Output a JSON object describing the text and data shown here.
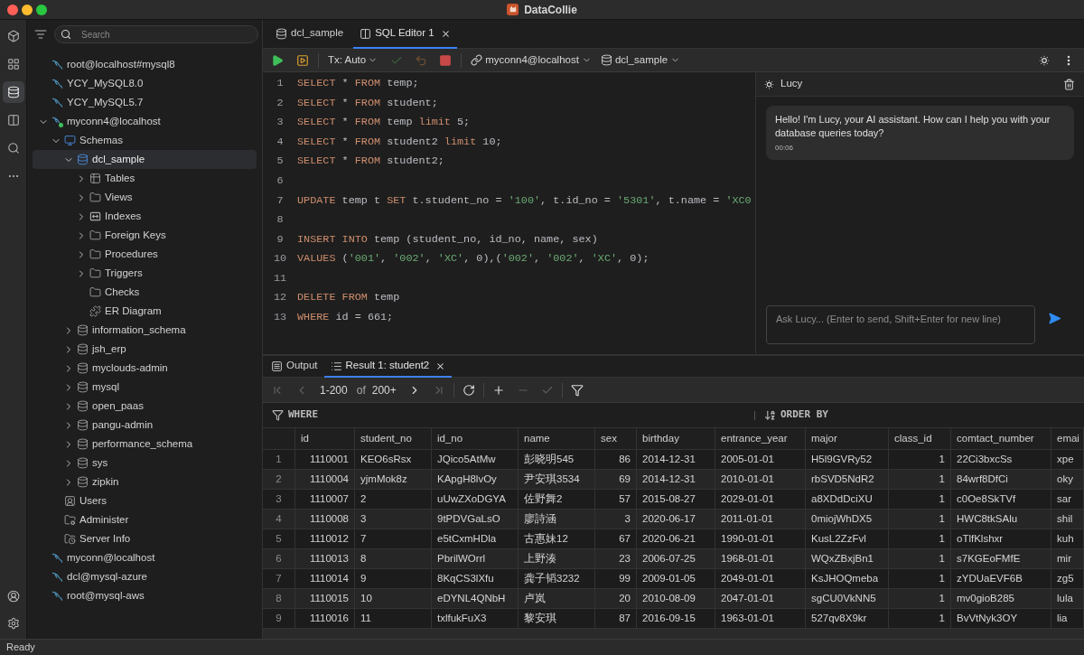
{
  "window": {
    "title": "DataCollie"
  },
  "activity_bar": {
    "items": [
      {
        "selected": false
      },
      {
        "selected": false
      },
      {
        "selected": true
      },
      {
        "selected": false
      },
      {
        "selected": false
      },
      {
        "selected": false
      }
    ]
  },
  "sidebar": {
    "search": {
      "placeholder": "Search"
    },
    "tree": [
      {
        "label": "root@localhost#mysql8",
        "kind": "connection",
        "connected": false,
        "selected": false
      },
      {
        "label": "YCY_MySQL8.0",
        "kind": "connection",
        "connected": false,
        "selected": false
      },
      {
        "label": "YCY_MySQL5.7",
        "kind": "connection",
        "connected": false,
        "selected": false
      },
      {
        "label": "myconn4@localhost",
        "kind": "connection",
        "connected": true,
        "expanded": true,
        "selected": false,
        "children": [
          {
            "label": "Schemas",
            "kind": "schemas",
            "expanded": true,
            "selected": false,
            "children": [
              {
                "label": "dcl_sample",
                "kind": "database",
                "expanded": true,
                "selected": true,
                "children": [
                  {
                    "label": "Tables",
                    "kind": "tables",
                    "expanded": false,
                    "selected": false
                  },
                  {
                    "label": "Views",
                    "kind": "folder",
                    "expanded": false,
                    "selected": false
                  },
                  {
                    "label": "Indexes",
                    "kind": "indexes",
                    "expanded": false,
                    "selected": false
                  },
                  {
                    "label": "Foreign Keys",
                    "kind": "folder",
                    "expanded": false,
                    "selected": false
                  },
                  {
                    "label": "Procedures",
                    "kind": "folder",
                    "expanded": false,
                    "selected": false
                  },
                  {
                    "label": "Triggers",
                    "kind": "folder",
                    "expanded": false,
                    "selected": false
                  },
                  {
                    "label": "Checks",
                    "kind": "folder",
                    "selected": false
                  },
                  {
                    "label": "ER Diagram",
                    "kind": "diagram",
                    "selected": false
                  }
                ]
              },
              {
                "label": "information_schema",
                "kind": "database",
                "expanded": false,
                "selected": false
              },
              {
                "label": "jsh_erp",
                "kind": "database",
                "expanded": false,
                "selected": false
              },
              {
                "label": "myclouds-admin",
                "kind": "database",
                "expanded": false,
                "selected": false
              },
              {
                "label": "mysql",
                "kind": "database",
                "expanded": false,
                "selected": false
              },
              {
                "label": "open_paas",
                "kind": "database",
                "expanded": false,
                "selected": false
              },
              {
                "label": "pangu-admin",
                "kind": "database",
                "expanded": false,
                "selected": false
              },
              {
                "label": "performance_schema",
                "kind": "database",
                "expanded": false,
                "selected": false
              },
              {
                "label": "sys",
                "kind": "database",
                "expanded": false,
                "selected": false
              },
              {
                "label": "zipkin",
                "kind": "database",
                "expanded": false,
                "selected": false
              }
            ]
          },
          {
            "label": "Users",
            "kind": "users",
            "selected": false
          },
          {
            "label": "Administer",
            "kind": "admin",
            "selected": false
          },
          {
            "label": "Server Info",
            "kind": "server-info",
            "selected": false
          }
        ]
      },
      {
        "label": "myconn@localhost",
        "kind": "connection",
        "connected": false,
        "selected": false
      },
      {
        "label": "dcl@mysql-azure",
        "kind": "connection",
        "connected": false,
        "selected": false
      },
      {
        "label": "root@mysql-aws",
        "kind": "connection",
        "connected": false,
        "selected": false
      }
    ]
  },
  "editor": {
    "tabs": [
      {
        "label": "dcl_sample",
        "kind": "database",
        "selected": false,
        "closable": false
      },
      {
        "label": "SQL Editor 1",
        "kind": "sql",
        "selected": true,
        "closable": true
      }
    ],
    "toolbar": {
      "actions": [
        {
          "disabled": false
        },
        {
          "disabled": false
        },
        {
          "disabled": true
        },
        {
          "disabled": true
        },
        {
          "disabled": false
        }
      ],
      "transaction": "Tx: Auto",
      "connection": "myconn4@localhost",
      "database": "dcl_sample"
    },
    "code": {
      "lines": [
        {
          "number": "1",
          "tokens": [
            {
              "kind": "keyword",
              "text": "SELECT"
            },
            {
              "kind": "plain",
              "text": " * "
            },
            {
              "kind": "keyword",
              "text": "FROM"
            },
            {
              "kind": "plain",
              "text": " temp;"
            }
          ]
        },
        {
          "number": "2",
          "tokens": [
            {
              "kind": "keyword",
              "text": "SELECT"
            },
            {
              "kind": "plain",
              "text": " * "
            },
            {
              "kind": "keyword",
              "text": "FROM"
            },
            {
              "kind": "plain",
              "text": " student;"
            }
          ]
        },
        {
          "number": "3",
          "tokens": [
            {
              "kind": "keyword",
              "text": "SELECT"
            },
            {
              "kind": "plain",
              "text": " * "
            },
            {
              "kind": "keyword",
              "text": "FROM"
            },
            {
              "kind": "plain",
              "text": " temp "
            },
            {
              "kind": "keyword",
              "text": "limit"
            },
            {
              "kind": "plain",
              "text": " 5;"
            }
          ]
        },
        {
          "number": "4",
          "tokens": [
            {
              "kind": "keyword",
              "text": "SELECT"
            },
            {
              "kind": "plain",
              "text": " * "
            },
            {
              "kind": "keyword",
              "text": "FROM"
            },
            {
              "kind": "plain",
              "text": " student2 "
            },
            {
              "kind": "keyword",
              "text": "limit"
            },
            {
              "kind": "plain",
              "text": " 10;"
            }
          ]
        },
        {
          "number": "5",
          "tokens": [
            {
              "kind": "keyword",
              "text": "SELECT"
            },
            {
              "kind": "plain",
              "text": " * "
            },
            {
              "kind": "keyword",
              "text": "FROM"
            },
            {
              "kind": "plain",
              "text": " student2;"
            }
          ]
        },
        {
          "number": "6"
        },
        {
          "number": "7",
          "tokens": [
            {
              "kind": "keyword",
              "text": "UPDATE"
            },
            {
              "kind": "plain",
              "text": " temp t "
            },
            {
              "kind": "keyword",
              "text": "SET"
            },
            {
              "kind": "plain",
              "text": " t.student_no = "
            },
            {
              "kind": "string",
              "text": "'100'"
            },
            {
              "kind": "plain",
              "text": ", t.id_no = "
            },
            {
              "kind": "string",
              "text": "'5301'"
            },
            {
              "kind": "plain",
              "text": ", t.name = "
            },
            {
              "kind": "string",
              "text": "'XC0"
            }
          ]
        },
        {
          "number": "8"
        },
        {
          "number": "9",
          "tokens": [
            {
              "kind": "keyword",
              "text": "INSERT INTO"
            },
            {
              "kind": "plain",
              "text": " temp (student_no, id_no, name, sex)"
            }
          ]
        },
        {
          "number": "10",
          "tokens": [
            {
              "kind": "keyword",
              "text": "VALUES"
            },
            {
              "kind": "plain",
              "text": " ("
            },
            {
              "kind": "string",
              "text": "'001'"
            },
            {
              "kind": "plain",
              "text": ", "
            },
            {
              "kind": "string",
              "text": "'002'"
            },
            {
              "kind": "plain",
              "text": ", "
            },
            {
              "kind": "string",
              "text": "'XC'"
            },
            {
              "kind": "plain",
              "text": ", 0),("
            },
            {
              "kind": "string",
              "text": "'002'"
            },
            {
              "kind": "plain",
              "text": ", "
            },
            {
              "kind": "string",
              "text": "'002'"
            },
            {
              "kind": "plain",
              "text": ", "
            },
            {
              "kind": "string",
              "text": "'XC'"
            },
            {
              "kind": "plain",
              "text": ", 0);"
            }
          ]
        },
        {
          "number": "11"
        },
        {
          "number": "12",
          "tokens": [
            {
              "kind": "keyword",
              "text": "DELETE FROM"
            },
            {
              "kind": "plain",
              "text": " temp"
            }
          ]
        },
        {
          "number": "13",
          "tokens": [
            {
              "kind": "keyword",
              "text": "WHERE"
            },
            {
              "kind": "plain",
              "text": " id = 661;"
            }
          ]
        }
      ]
    }
  },
  "assistant": {
    "title": "Lucy",
    "messages": [
      {
        "text": "Hello! I'm Lucy, your AI assistant. How can I help you with your database queries today?",
        "time": "00:06"
      }
    ],
    "input": {
      "placeholder": "Ask Lucy... (Enter to send, Shift+Enter for new line)"
    }
  },
  "results": {
    "tabs": [
      {
        "label": "Output",
        "kind": "output",
        "selected": false,
        "closable": false
      },
      {
        "label": "Result 1: student2",
        "kind": "result",
        "selected": true,
        "closable": true
      }
    ],
    "pager": {
      "nav": [
        {
          "disabled": true
        },
        {
          "disabled": true
        },
        {
          "disabled": false
        },
        {
          "disabled": true
        }
      ],
      "range": "1-200",
      "of": "of",
      "total": "200+",
      "edit": [
        {
          "disabled": false
        },
        {
          "disabled": true
        },
        {
          "disabled": true
        }
      ]
    },
    "filters": {
      "where": "WHERE",
      "order_by": "ORDER BY"
    },
    "table": {
      "columns": [
        {
          "label": "id",
          "kind": "number"
        },
        {
          "label": "student_no",
          "kind": "text"
        },
        {
          "label": "id_no",
          "kind": "text"
        },
        {
          "label": "name",
          "kind": "text"
        },
        {
          "label": "sex",
          "kind": "number"
        },
        {
          "label": "birthday",
          "kind": "text"
        },
        {
          "label": "entrance_year",
          "kind": "text"
        },
        {
          "label": "major",
          "kind": "text"
        },
        {
          "label": "class_id",
          "kind": "number"
        },
        {
          "label": "comtact_number",
          "kind": "text"
        },
        {
          "label": "emai",
          "kind": "text"
        }
      ],
      "rows": [
        {
          "number": "1",
          "cells": [
            "1110001",
            "KEO6sRsx",
            "JQico5AtMw",
            "彭晓明545",
            "86",
            "2014-12-31",
            "2005-01-01",
            "H5l9GVRy52",
            "1",
            "22Ci3bxcSs",
            "xpe"
          ]
        },
        {
          "number": "2",
          "cells": [
            "1110004",
            "yjmMok8z",
            "KApgH8lvOy",
            "尹安琪3534",
            "69",
            "2014-12-31",
            "2010-01-01",
            "rbSVD5NdR2",
            "1",
            "84wrf8DfCi",
            "oky"
          ]
        },
        {
          "number": "3",
          "cells": [
            "1110007",
            "2",
            "uUwZXoDGYA",
            "佐野舞2",
            "57",
            "2015-08-27",
            "2029-01-01",
            "a8XDdDciXU",
            "1",
            "c0Oe8SkTVf",
            "sar"
          ]
        },
        {
          "number": "4",
          "cells": [
            "1110008",
            "3",
            "9tPDVGaLsO",
            "廖詩涵",
            "3",
            "2020-06-17",
            "2011-01-01",
            "0miojWhDX5",
            "1",
            "HWC8tkSAlu",
            "shil"
          ]
        },
        {
          "number": "5",
          "cells": [
            "1110012",
            "7",
            "e5tCxmHDla",
            "古惠妹12",
            "67",
            "2020-06-21",
            "1990-01-01",
            "KusL2ZzFvl",
            "1",
            "oTlfKlshxr",
            "kuh"
          ]
        },
        {
          "number": "6",
          "cells": [
            "1110013",
            "8",
            "PbrilWOrrl",
            "上野湊",
            "23",
            "2006-07-25",
            "1968-01-01",
            "WQxZBxjBn1",
            "1",
            "s7KGEoFMfE",
            "mir"
          ]
        },
        {
          "number": "7",
          "cells": [
            "1110014",
            "9",
            "8KqCS3lXfu",
            "龚子韬3232",
            "99",
            "2009-01-05",
            "2049-01-01",
            "KsJHOQmeba",
            "1",
            "zYDUaEVF6B",
            "zg5"
          ]
        },
        {
          "number": "8",
          "cells": [
            "1110015",
            "10",
            "eDYNL4QNbH",
            "卢岚",
            "20",
            "2010-08-09",
            "2047-01-01",
            "sgCU0VkNN5",
            "1",
            "mv0gioB285",
            "lula"
          ]
        },
        {
          "number": "9",
          "cells": [
            "1110016",
            "11",
            "txlfukFuX3",
            "黎安琪",
            "87",
            "2016-09-15",
            "1963-01-01",
            "527qv8X9kr",
            "1",
            "BvVtNyk3OY",
            "lia"
          ]
        }
      ]
    }
  },
  "status_bar": {
    "text": "Ready"
  }
}
